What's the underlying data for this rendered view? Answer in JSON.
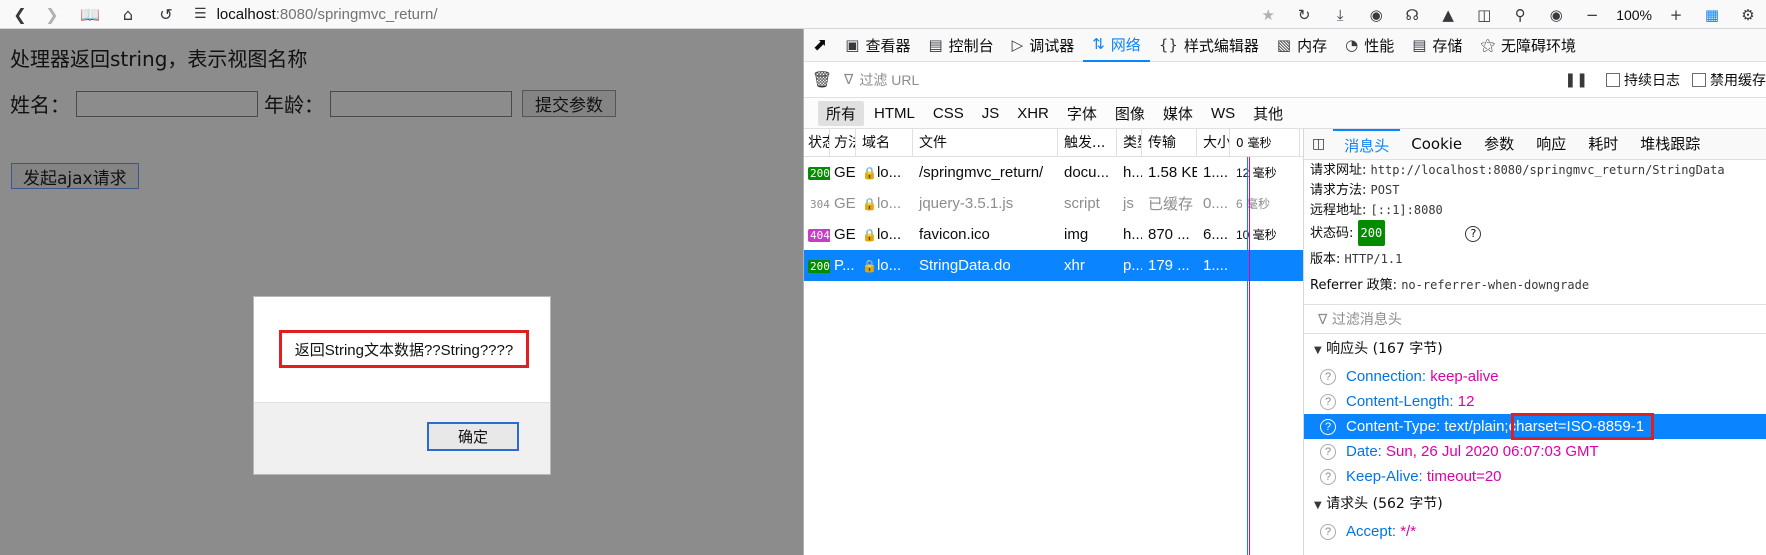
{
  "browser": {
    "url_host": "localhost",
    "url_path": ":8080/springmvc_return/",
    "zoom": "100%"
  },
  "page": {
    "title": "处理器返回string，表示视图名称",
    "name_label": "姓名：",
    "age_label": "年龄：",
    "submit_label": "提交参数",
    "ajax_label": "发起ajax请求"
  },
  "modal": {
    "message": "返回String文本数据??String????",
    "ok_label": "确定"
  },
  "devtools": {
    "tabs": [
      {
        "icon": "inspector-icon",
        "label": "查看器"
      },
      {
        "icon": "console-icon",
        "label": "控制台"
      },
      {
        "icon": "debugger-icon",
        "label": "调试器"
      },
      {
        "icon": "network-icon",
        "label": "网络"
      },
      {
        "icon": "style-editor-icon",
        "label": "样式编辑器"
      },
      {
        "icon": "memory-icon",
        "label": "内存"
      },
      {
        "icon": "performance-icon",
        "label": "性能"
      },
      {
        "icon": "storage-icon",
        "label": "存储"
      },
      {
        "icon": "accessibility-icon",
        "label": "无障碍环境"
      }
    ],
    "filter_placeholder": "过滤 URL",
    "persist_logs": "持续日志",
    "disable_cache": "禁用缓存",
    "type_filters": [
      "所有",
      "HTML",
      "CSS",
      "JS",
      "XHR",
      "字体",
      "图像",
      "媒体",
      "WS",
      "其他"
    ],
    "columns": [
      "状态",
      "方法",
      "域名",
      "文件",
      "触发...",
      "类型",
      "传输",
      "大小",
      "0 毫秒"
    ],
    "requests": [
      {
        "status": "200",
        "method": "GET",
        "domain": "lo...",
        "file": "/springmvc_return/",
        "cause": "docu...",
        "type": "h...",
        "transferred": "1.58 KB",
        "size": "1....",
        "time": "12 毫秒"
      },
      {
        "status": "304",
        "method": "GET",
        "domain": "lo...",
        "file": "jquery-3.5.1.js",
        "cause": "script",
        "type": "js",
        "transferred": "已缓存",
        "size": "0....",
        "time": "6 毫秒"
      },
      {
        "status": "404",
        "method": "GET",
        "domain": "lo...",
        "file": "favicon.ico",
        "cause": "img",
        "type": "h...",
        "transferred": "870 ...",
        "size": "6....",
        "time": "10 毫秒"
      },
      {
        "status": "200",
        "method": "P...",
        "domain": "lo...",
        "file": "StringData.do",
        "cause": "xhr",
        "type": "p...",
        "transferred": "179 ...",
        "size": "1....",
        "time": ""
      }
    ],
    "detail_tabs": [
      "消息头",
      "Cookie",
      "参数",
      "响应",
      "耗时",
      "堆栈跟踪"
    ],
    "request_url_label": "请求网址:",
    "request_url": "http://localhost:8080/springmvc_return/StringData",
    "method_label": "请求方法:",
    "method": "POST",
    "remote_label": "远程地址:",
    "remote": "[::1]:8080",
    "status_label": "状态码:",
    "status": "200",
    "version_label": "版本:",
    "version": "HTTP/1.1",
    "referrer_label": "Referrer 政策:",
    "referrer": "no-referrer-when-downgrade",
    "header_filter": "过滤消息头",
    "response_headers_title": "响应头 (167 字节)",
    "response_headers": [
      {
        "name": "Connection:",
        "value": " keep-alive"
      },
      {
        "name": "Content-Length:",
        "value": " 12"
      },
      {
        "name": "Content-Type:",
        "value": " text/plain;charset=ISO-8859-1"
      },
      {
        "name": "Date:",
        "value": " Sun, 26 Jul 2020 06:07:03 GMT"
      },
      {
        "name": "Keep-Alive:",
        "value": " timeout=20"
      }
    ],
    "request_headers_title": "请求头 (562 字节)",
    "request_headers": [
      {
        "name": "Accept:",
        "value": " */*"
      }
    ]
  }
}
